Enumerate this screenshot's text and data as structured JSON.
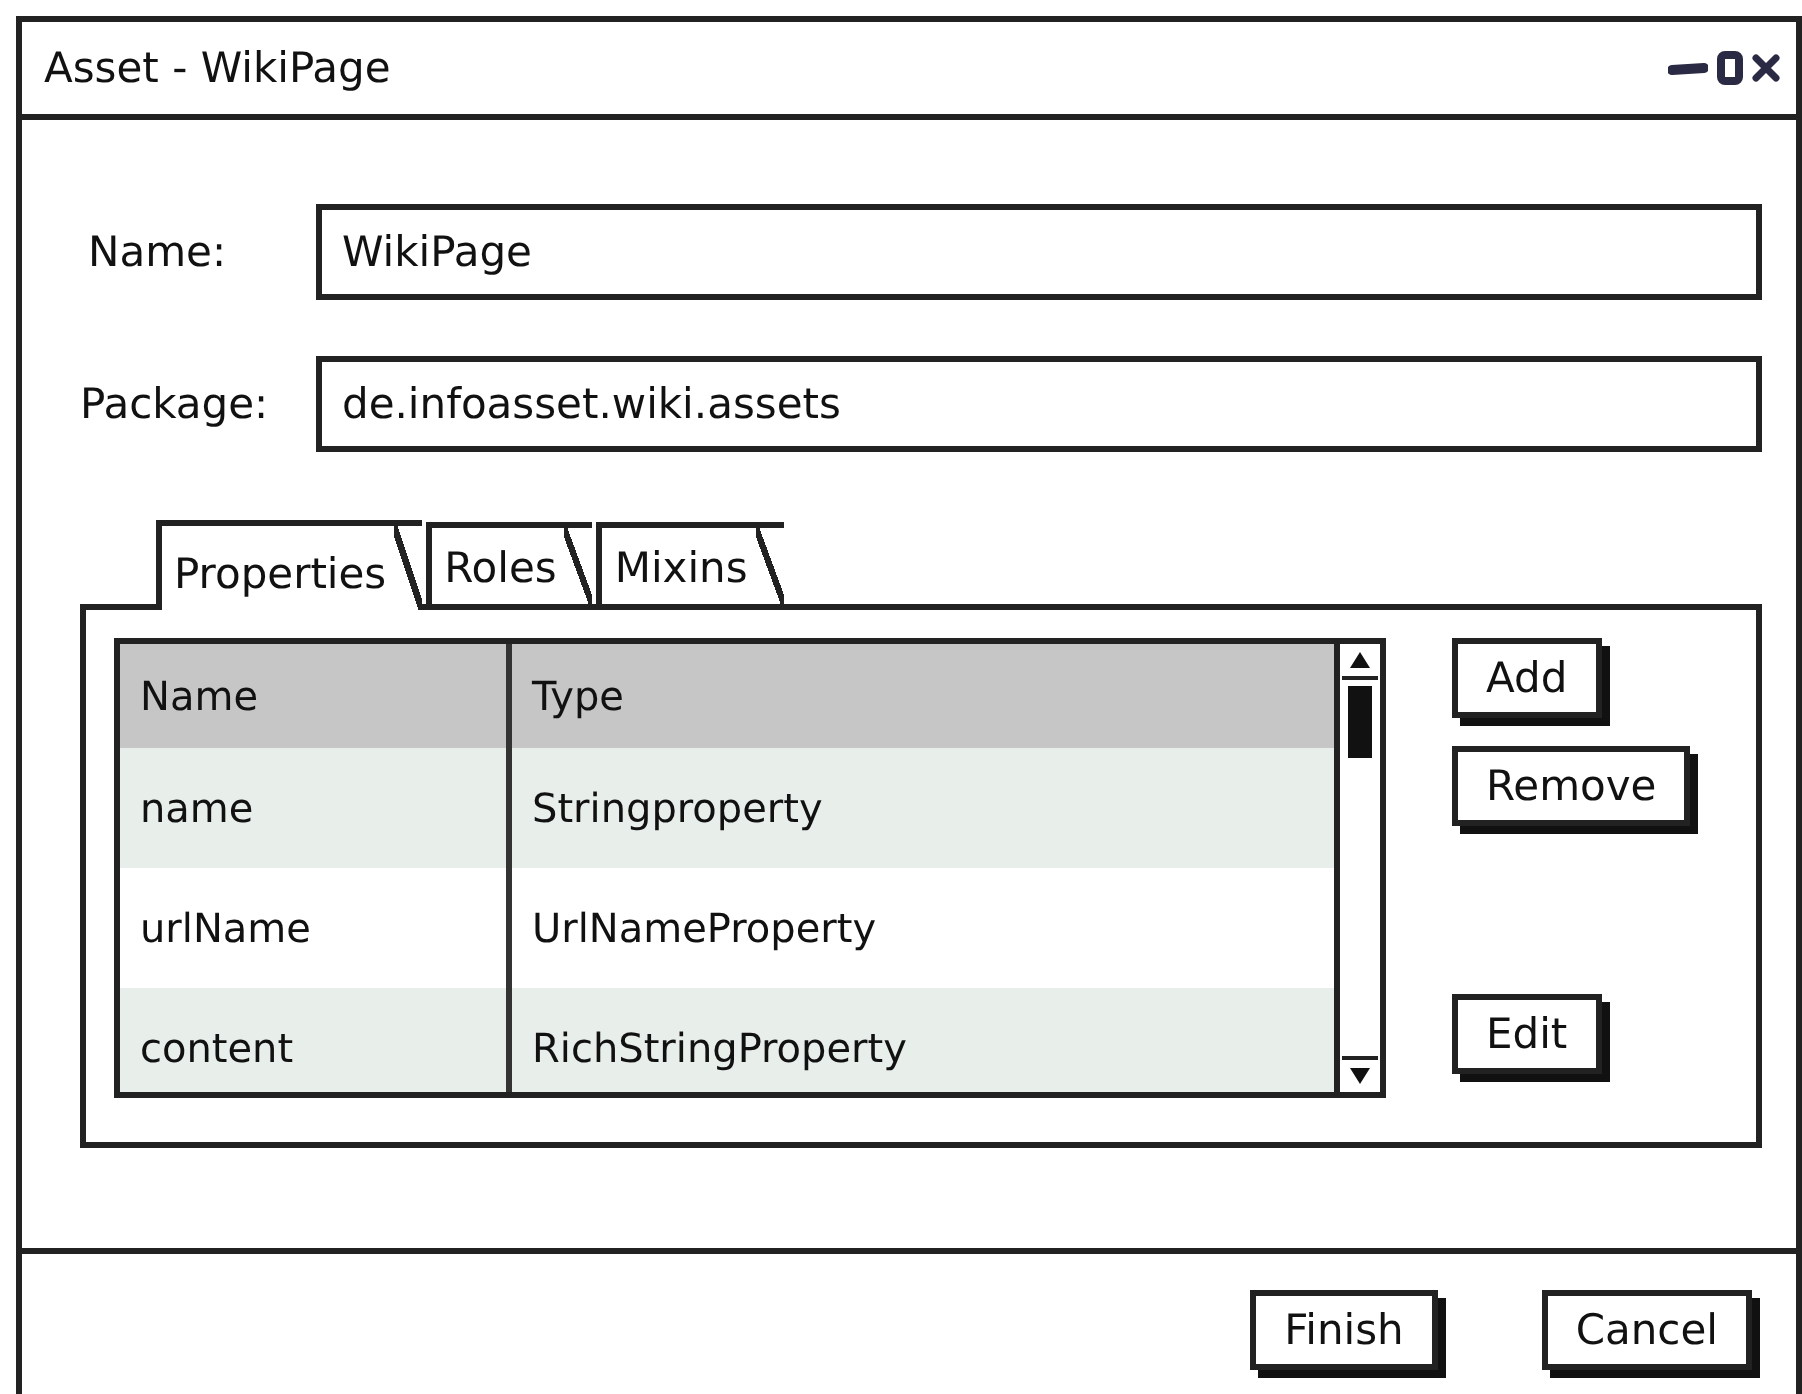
{
  "window": {
    "title": "Asset - WikiPage"
  },
  "fields": [
    {
      "label": "Name:",
      "value": "WikiPage"
    },
    {
      "label": "Package:",
      "value": "de.infoasset.wiki.assets"
    }
  ],
  "tabs": [
    {
      "label": "Properties",
      "selected": true
    },
    {
      "label": "Roles",
      "selected": false
    },
    {
      "label": "Mixins",
      "selected": false
    }
  ],
  "table": {
    "columns": [
      "Name",
      "Type"
    ],
    "rows": [
      [
        "name",
        "Stringproperty"
      ],
      [
        "urlName",
        "UrlNameProperty"
      ],
      [
        "content",
        "RichStringProperty"
      ]
    ]
  },
  "side_buttons": [
    {
      "label": "Add",
      "kind": "button"
    },
    {
      "label": "Remove",
      "kind": "button"
    },
    {
      "kind": "gap"
    },
    {
      "label": "Edit",
      "kind": "button"
    }
  ],
  "footer_buttons": [
    "Finish",
    "Cancel"
  ]
}
